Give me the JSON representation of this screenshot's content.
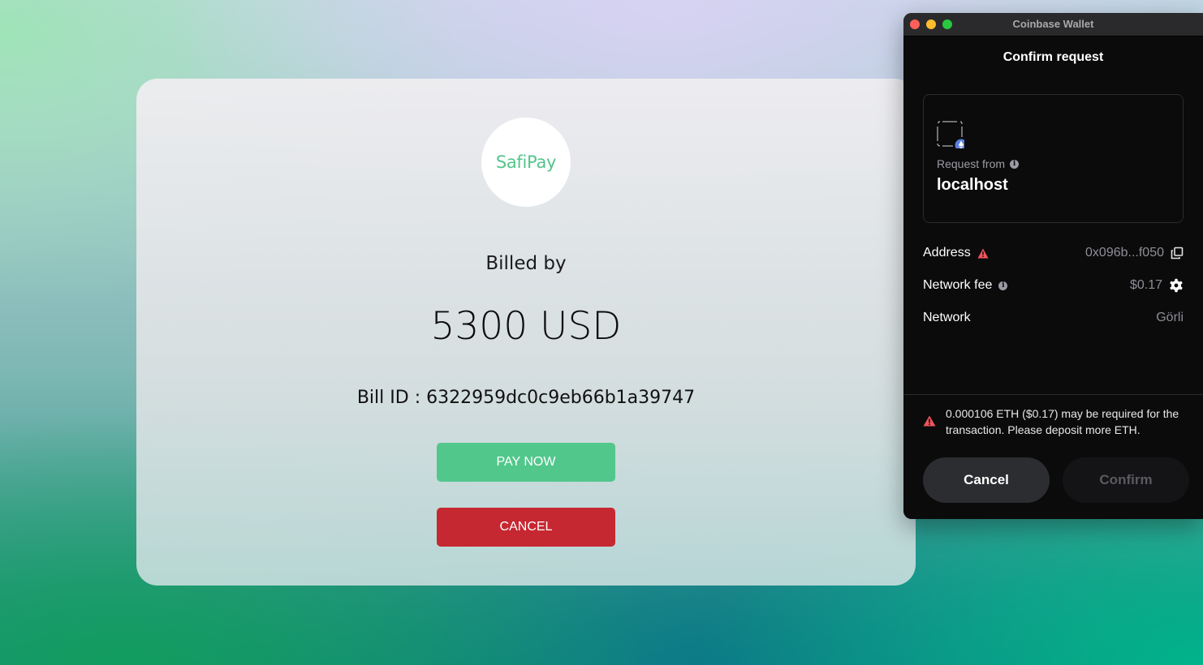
{
  "billing": {
    "logo_text": "SafiPay",
    "billed_by": "Billed by",
    "amount": "5300 USD",
    "bill_id": "Bill ID : 6322959dc0c9eb66b1a39747",
    "pay_now_label": "PAY NOW",
    "cancel_label": "CANCEL",
    "colors": {
      "pay": "#52c78c",
      "cancel": "#c62832",
      "logo": "#55c58c"
    }
  },
  "wallet": {
    "window_title": "Coinbase Wallet",
    "header": "Confirm request",
    "request_from_label": "Request from",
    "request_host": "localhost",
    "rows": {
      "address": {
        "label": "Address",
        "value": "0x096b...f050"
      },
      "network_fee": {
        "label": "Network fee",
        "value": "$0.17"
      },
      "network": {
        "label": "Network",
        "value": "Görli"
      }
    },
    "warning": "0.000106 ETH ($0.17) may be required for the transaction. Please deposit more ETH.",
    "cancel_label": "Cancel",
    "confirm_label": "Confirm",
    "icons": [
      "warning-icon",
      "copy-icon",
      "info-icon",
      "gear-icon",
      "eth-icon"
    ]
  }
}
